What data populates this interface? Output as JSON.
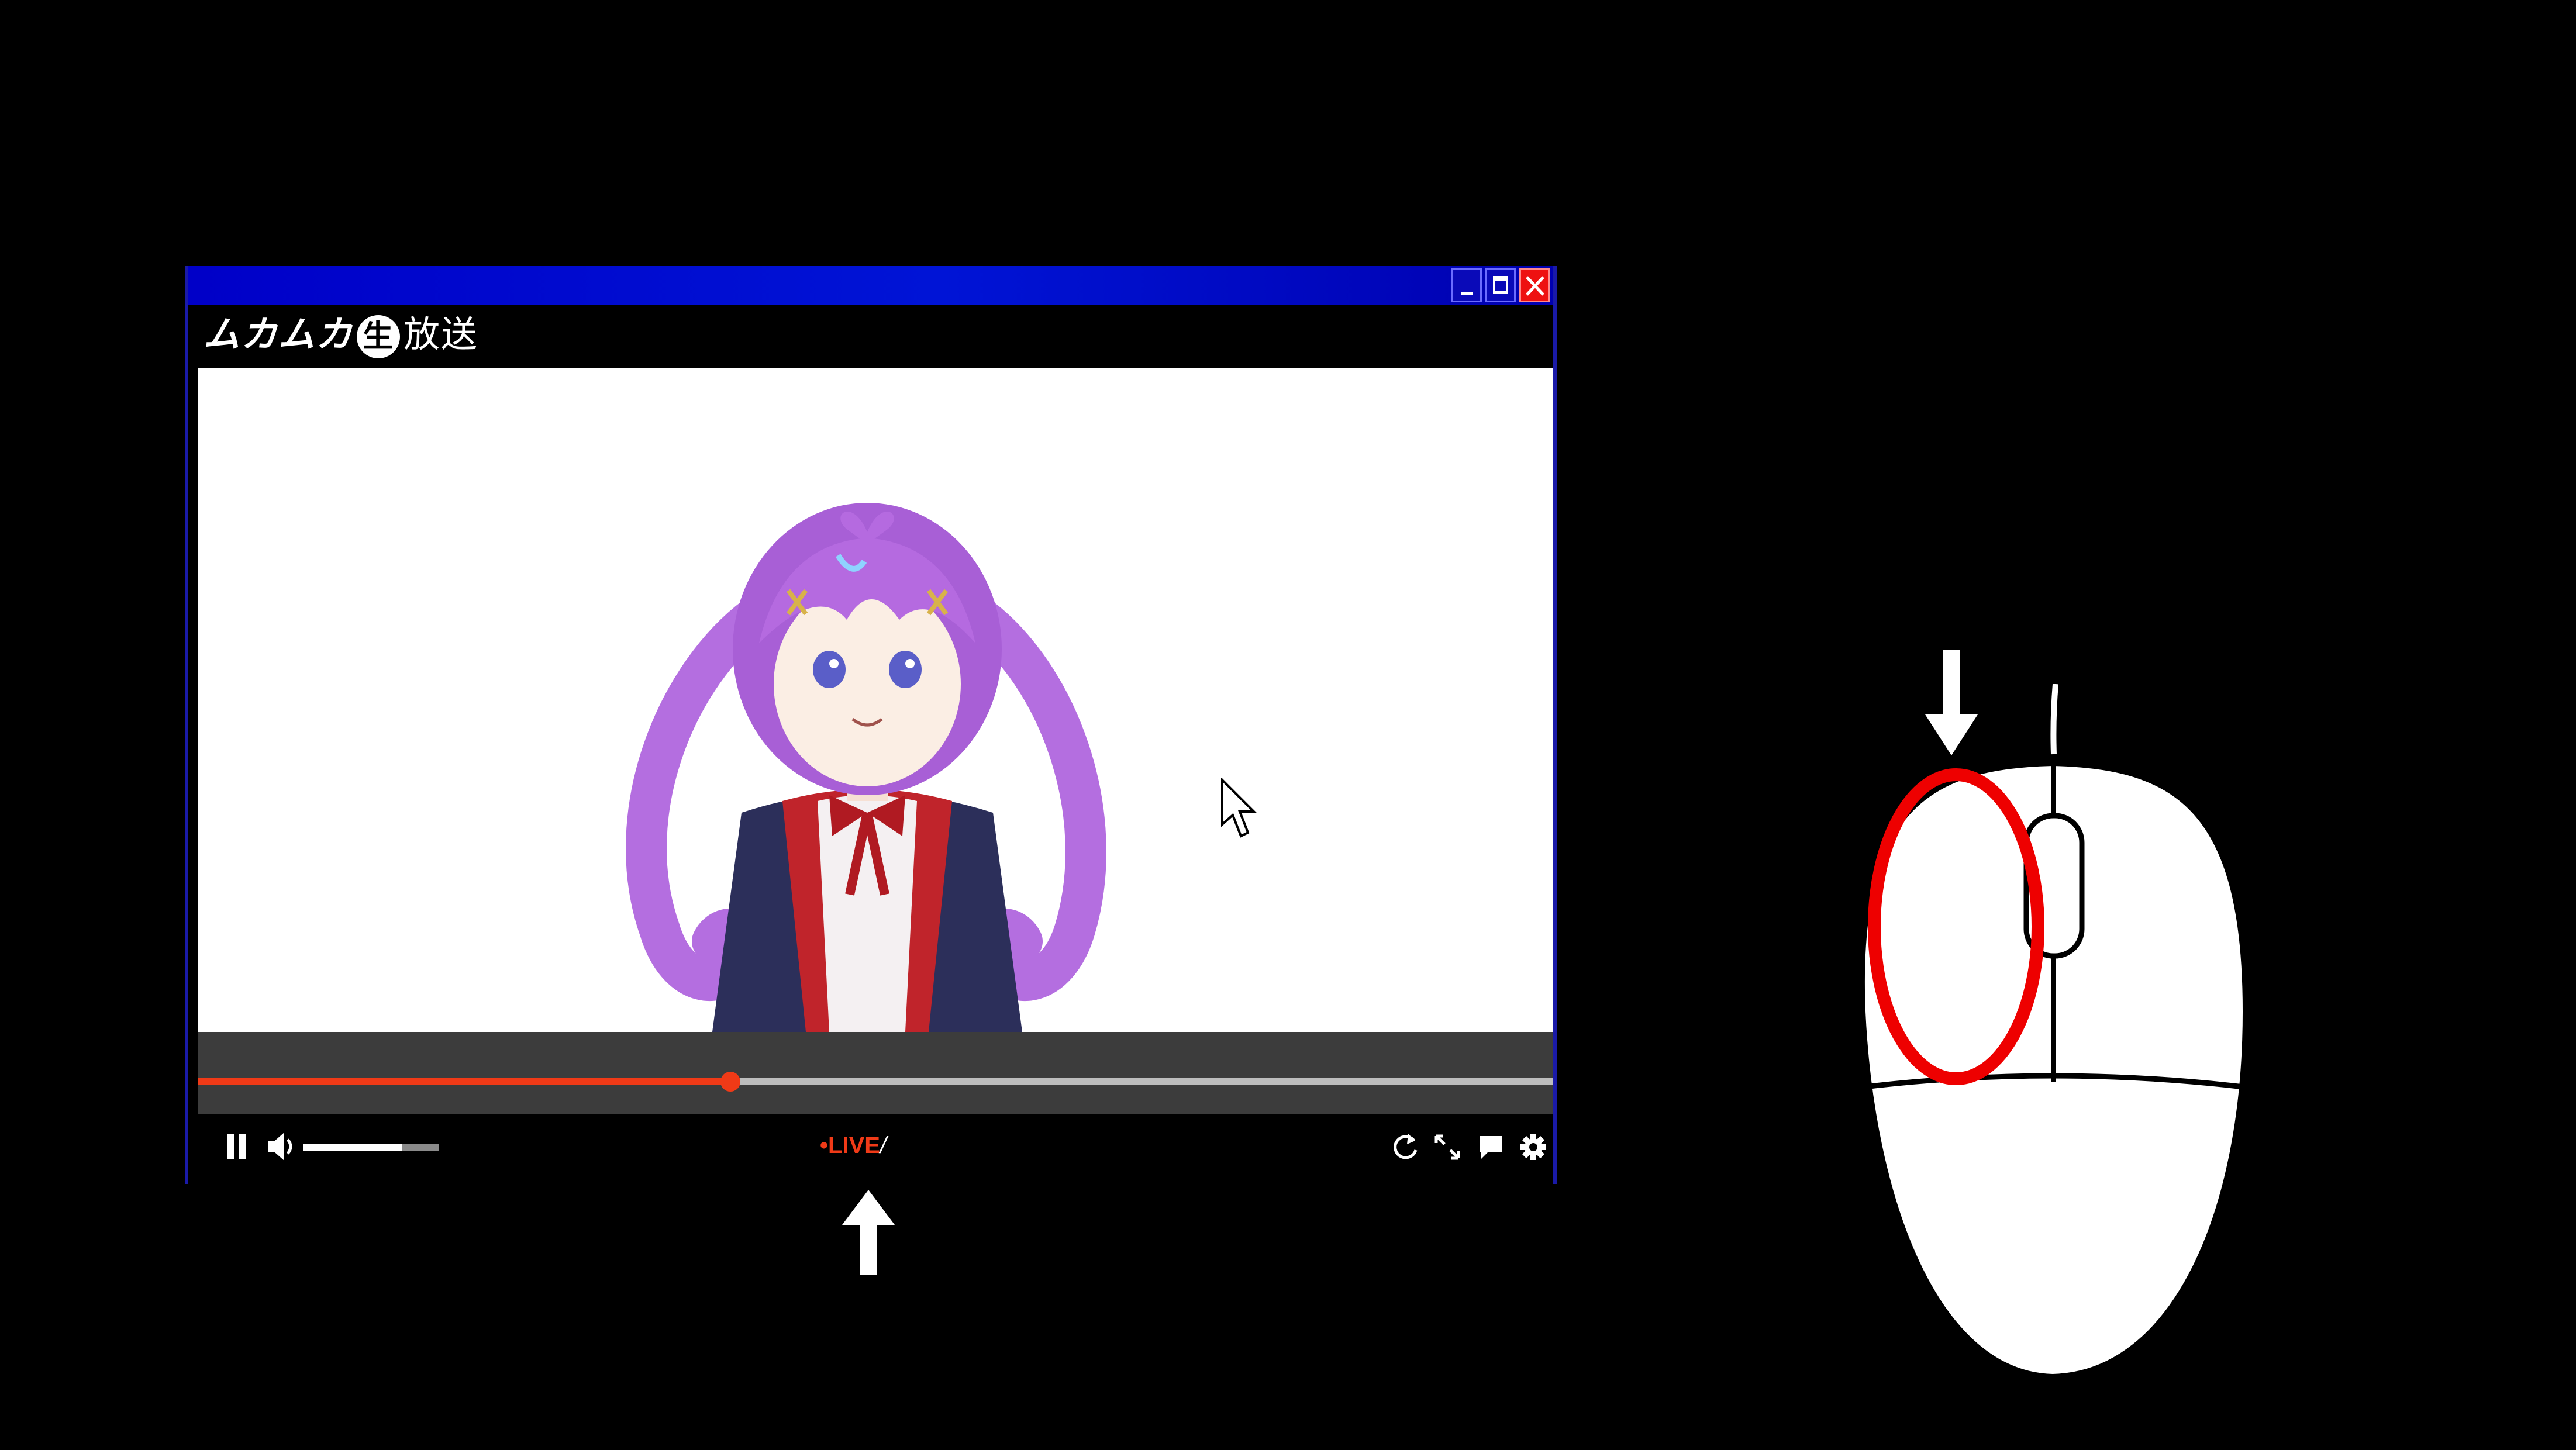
{
  "player": {
    "brand": {
      "prefix": "ムカムカ",
      "badge": "生",
      "suffix": "放送"
    },
    "window_buttons": {
      "minimize": "minimize-icon",
      "maximize": "maximize-icon",
      "close": "close-icon"
    },
    "live_label": "LIVE",
    "live_suffix": "/",
    "progress": 0.393,
    "volume": 0.73,
    "controls_right": [
      "refresh-icon",
      "fullscreen-icon",
      "comment-icon",
      "gear-icon"
    ]
  },
  "colors": {
    "titlebar": "#0000c8",
    "accent": "#f03a17",
    "highlight_ring": "#ee0000"
  },
  "overlay": {
    "up_arrow": "arrow-up-icon",
    "down_arrow": "arrow-down-icon",
    "mouse_illustration": "mouse-icon",
    "highlight": "left-click-highlight"
  }
}
